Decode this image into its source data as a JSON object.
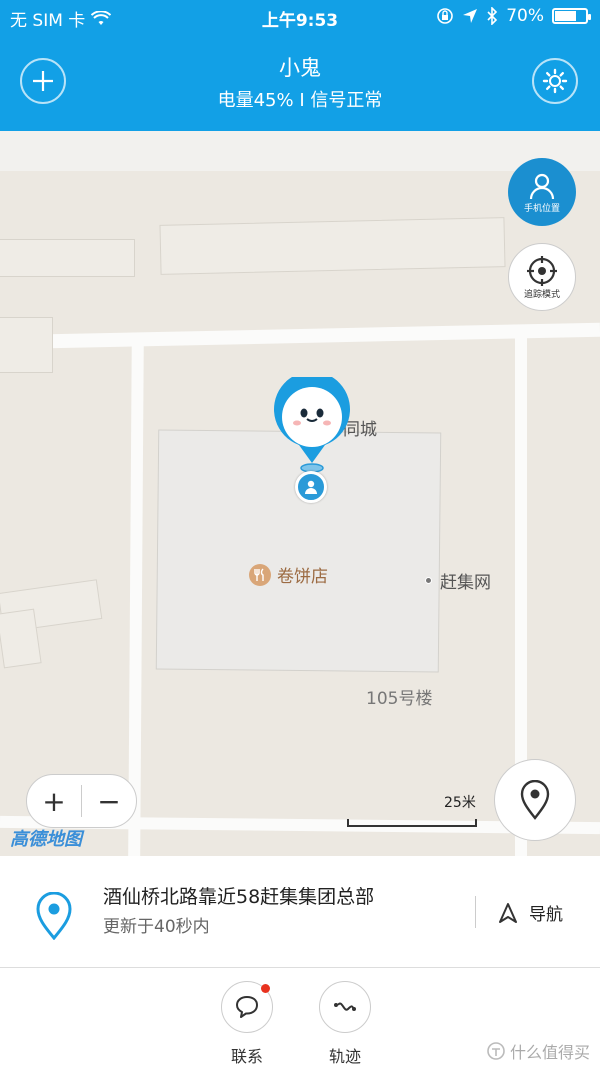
{
  "status_bar": {
    "carrier": "无 SIM 卡",
    "time": "上午9:53",
    "battery_percent": "70%",
    "battery_level": 0.7
  },
  "header": {
    "title": "小鬼",
    "subtitle": "电量45% I 信号正常"
  },
  "map": {
    "buttons": {
      "phone_location": "手机位置",
      "track_mode": "追踪模式"
    },
    "labels": {
      "building_partial": "同城",
      "poi_restaurant": "卷饼店",
      "poi_ganji": "赶集网",
      "building_105": "105号楼"
    },
    "scale": "25米",
    "logo": "高德地图",
    "zoom_in": "+",
    "zoom_out": "−"
  },
  "address": {
    "line": "酒仙桥北路靠近58赶集集团总部",
    "updated": "更新于40秒内",
    "nav_label": "导航"
  },
  "tabs": [
    {
      "label": "联系",
      "has_badge": true
    },
    {
      "label": "轨迹",
      "has_badge": false
    }
  ],
  "watermark": "什么值得买",
  "colors": {
    "brand_blue": "#12a0e6",
    "badge_red": "#e8321f"
  }
}
